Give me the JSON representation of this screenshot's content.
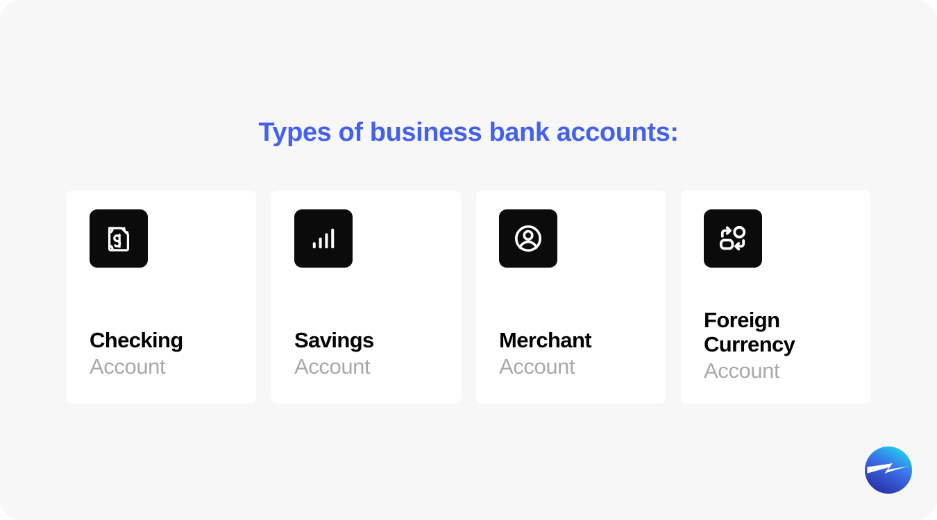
{
  "page": {
    "background_color": "#f7f7f8",
    "corner_radius_px": 30
  },
  "header": {
    "title": "Types of business bank accounts:",
    "title_color": "#4361ee"
  },
  "cards": [
    {
      "icon_name": "money-bill-icon",
      "icon_tile_color": "#0b0b0b",
      "title": "Checking",
      "subtitle": "Account"
    },
    {
      "icon_name": "bar-chart-icon",
      "icon_tile_color": "#0b0b0b",
      "title": "Savings",
      "subtitle": "Account"
    },
    {
      "icon_name": "user-circle-icon",
      "icon_tile_color": "#0b0b0b",
      "title": "Merchant",
      "subtitle": "Account"
    },
    {
      "icon_name": "currency-exchange-icon",
      "icon_tile_color": "#0b0b0b",
      "title": "Foreign Currency",
      "subtitle": "Account"
    }
  ],
  "logo": {
    "name": "lightning-bolt-logo",
    "gradient_start": "#22c8f0",
    "gradient_mid": "#3b6ee8",
    "gradient_end": "#2b2fa8",
    "bolt_color": "#ffffff"
  }
}
